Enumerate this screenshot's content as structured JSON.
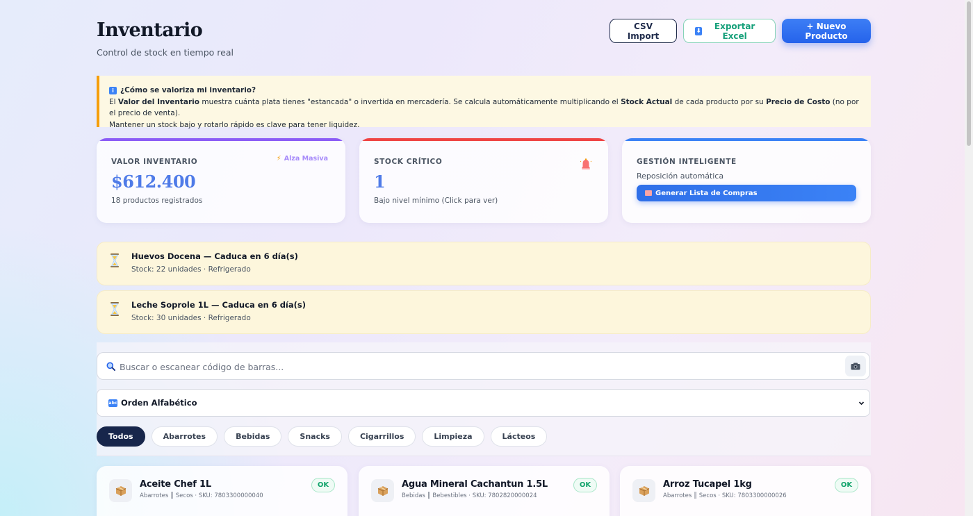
{
  "header": {
    "title": "Inventario",
    "subtitle": "Control de stock en tiempo real",
    "csv_import_label": "CSV Import",
    "export_excel_label": "Exportar Excel",
    "export_icon_glyph": "⬇",
    "new_product_label": "+ Nuevo Producto"
  },
  "info_banner": {
    "icon_glyph": "i",
    "title": "¿Cómo se valoriza mi inventario?",
    "text_1": "El ",
    "bold_1": "Valor del Inventario",
    "text_2": " muestra cuánta plata tienes \"estancada\" o invertida en mercadería. Se calcula automáticamente multiplicando el ",
    "bold_2": "Stock Actual",
    "text_3": " de cada producto por su ",
    "bold_3": "Precio de Costo",
    "text_4": " (no por el precio de venta).",
    "text_5": "Mantener un stock bajo y rotarlo rápido es clave para tener liquidez."
  },
  "cards": {
    "inventory_value": {
      "label": "VALOR INVENTARIO",
      "value": "$612.400",
      "sub": "18 productos registrados",
      "bulk_raise_label": "Alza Masiva",
      "bolt_glyph": "⚡",
      "accent_color": "#8b5cf6"
    },
    "critical_stock": {
      "label": "STOCK CRÍTICO",
      "value": "1",
      "sub": "Bajo nivel mínimo (Click para ver)",
      "icon": "bell-icon",
      "accent_color": "#ef4444"
    },
    "smart_management": {
      "label": "GESTIÓN INTELIGENTE",
      "sub": "Reposición automática",
      "button_label": "Generar Lista de Compras",
      "accent_color": "#3b82f6"
    }
  },
  "alerts": [
    {
      "title": "Huevos Docena — Caduca en 6 día(s)",
      "sub": "Stock: 22 unidades · Refrigerado",
      "icon": "hourglass-icon"
    },
    {
      "title": "Leche Soprole 1L — Caduca en 6 día(s)",
      "sub": "Stock: 30 unidades · Refrigerado",
      "icon": "hourglass-icon"
    }
  ],
  "search": {
    "placeholder": "Buscar o escanear código de barras...",
    "value": ""
  },
  "sort": {
    "selected": "Orden Alfabético",
    "icon_glyph": "abc"
  },
  "categories": [
    "Todos",
    "Abarrotes",
    "Bebidas",
    "Snacks",
    "Cigarrillos",
    "Limpieza",
    "Lácteos"
  ],
  "products": [
    {
      "name": "Aceite Chef 1L",
      "meta": "Abarrotes ║ Secos · SKU: 7803300000040",
      "status": "OK"
    },
    {
      "name": "Agua Mineral Cachantun 1.5L",
      "meta": "Bebidas ║ Bebestibles · SKU: 7802820000024",
      "status": "OK"
    },
    {
      "name": "Arroz Tucapel 1kg",
      "meta": "Abarrotes ║ Secos · SKU: 7803300000026",
      "status": "OK"
    }
  ],
  "colors": {
    "primary": "#2563eb",
    "navy": "#17264b",
    "success": "#10a36b",
    "warning_bg": "#fdf6dc",
    "warning_border": "#f59e0b"
  }
}
